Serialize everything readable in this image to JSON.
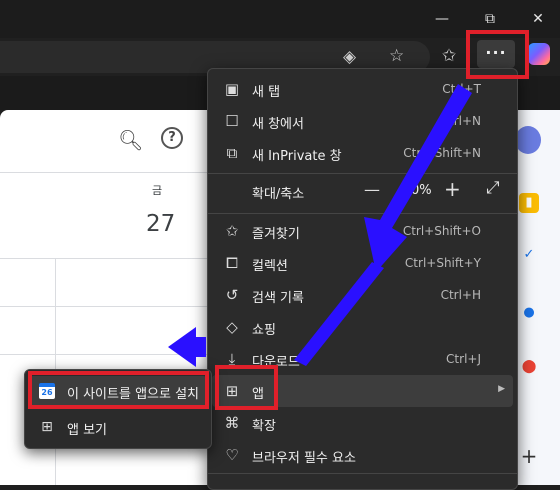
{
  "window_controls": {
    "minimize": "—",
    "maximize": "⧉",
    "close": "✕"
  },
  "toolbar": {
    "more_label": "···"
  },
  "page": {
    "day_label": "금",
    "day_number": "27"
  },
  "menu": {
    "items": [
      {
        "label": "새 탭",
        "shortcut": "Ctrl+T",
        "icon": "new-tab-icon"
      },
      {
        "label": "새 창에서",
        "shortcut": "Ctrl+N",
        "icon": "new-window-icon"
      },
      {
        "label": "새 InPrivate 창",
        "shortcut": "Ctrl+Shift+N",
        "icon": "inprivate-icon"
      },
      {
        "label": "즐겨찾기",
        "shortcut": "Ctrl+Shift+O",
        "icon": "favorites-icon"
      },
      {
        "label": "컬렉션",
        "shortcut": "Ctrl+Shift+Y",
        "icon": "collections-icon"
      },
      {
        "label": "검색 기록",
        "shortcut": "Ctrl+H",
        "icon": "history-icon"
      },
      {
        "label": "쇼핑",
        "shortcut": "",
        "icon": "shopping-icon"
      },
      {
        "label": "다운로드",
        "shortcut": "Ctrl+J",
        "icon": "download-icon"
      },
      {
        "label": "앱",
        "shortcut": "",
        "icon": "apps-icon"
      },
      {
        "label": "확장",
        "shortcut": "",
        "icon": "extensions-icon"
      },
      {
        "label": "브라우저 필수 요소",
        "shortcut": "",
        "icon": "heart-pulse-icon"
      }
    ],
    "zoom": {
      "label": "확대/축소",
      "value": "0%"
    }
  },
  "submenu": {
    "install_label": "이 사이트를 앱으로 설치",
    "install_icon_text": "26",
    "view_label": "앱 보기"
  },
  "annotation_color": "#e0202a",
  "arrow_color": "#2a10ff"
}
